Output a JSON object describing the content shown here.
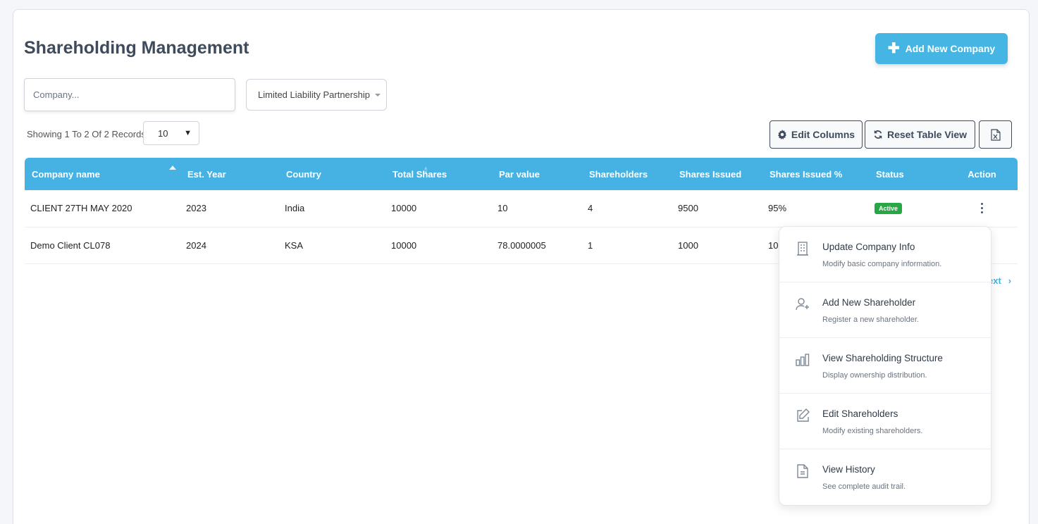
{
  "page": {
    "title": "Shareholding Management",
    "add_button_label": "Add New Company"
  },
  "filters": {
    "company_placeholder": "Company...",
    "company_type_selected": "Limited Liability Partnership"
  },
  "records": {
    "showing_text": "Showing 1 To 2 Of 2 Records",
    "page_size": "10"
  },
  "toolbar": {
    "edit_columns_label": "Edit Columns",
    "reset_view_label": "Reset Table View",
    "export_icon": "excel-file-icon"
  },
  "table": {
    "columns": [
      "Company name",
      "Est. Year",
      "Country",
      "Total Shares",
      "Par value",
      "Shareholders",
      "Shares Issued",
      "Shares Issued %",
      "Status",
      "Action"
    ],
    "rows": [
      {
        "company": "CLIENT 27TH MAY 2020",
        "year": "2023",
        "country": "India",
        "total_shares": "10000",
        "par_value": "10",
        "shareholders": "4",
        "shares_issued": "9500",
        "issued_pct": "95%",
        "status": "Active"
      },
      {
        "company": "Demo Client CL078",
        "year": "2024",
        "country": "KSA",
        "total_shares": "10000",
        "par_value": "78.0000005",
        "shareholders": "1",
        "shares_issued": "1000",
        "issued_pct": "10",
        "status": ""
      }
    ]
  },
  "pagination": {
    "next_label": "ext"
  },
  "action_menu": {
    "items": [
      {
        "title": "Update Company Info",
        "desc": "Modify basic company information.",
        "icon": "building-icon"
      },
      {
        "title": "Add New Shareholder",
        "desc": "Register a new shareholder.",
        "icon": "user-plus-icon"
      },
      {
        "title": "View Shareholding Structure",
        "desc": "Display ownership distribution.",
        "icon": "bar-chart-icon"
      },
      {
        "title": "Edit Shareholders",
        "desc": "Modify existing shareholders.",
        "icon": "edit-icon"
      },
      {
        "title": "View History",
        "desc": "See complete audit trail.",
        "icon": "document-icon"
      }
    ]
  },
  "colors": {
    "accent": "#45b2e3",
    "title": "#3d4b5c",
    "active_badge": "#28a745"
  }
}
